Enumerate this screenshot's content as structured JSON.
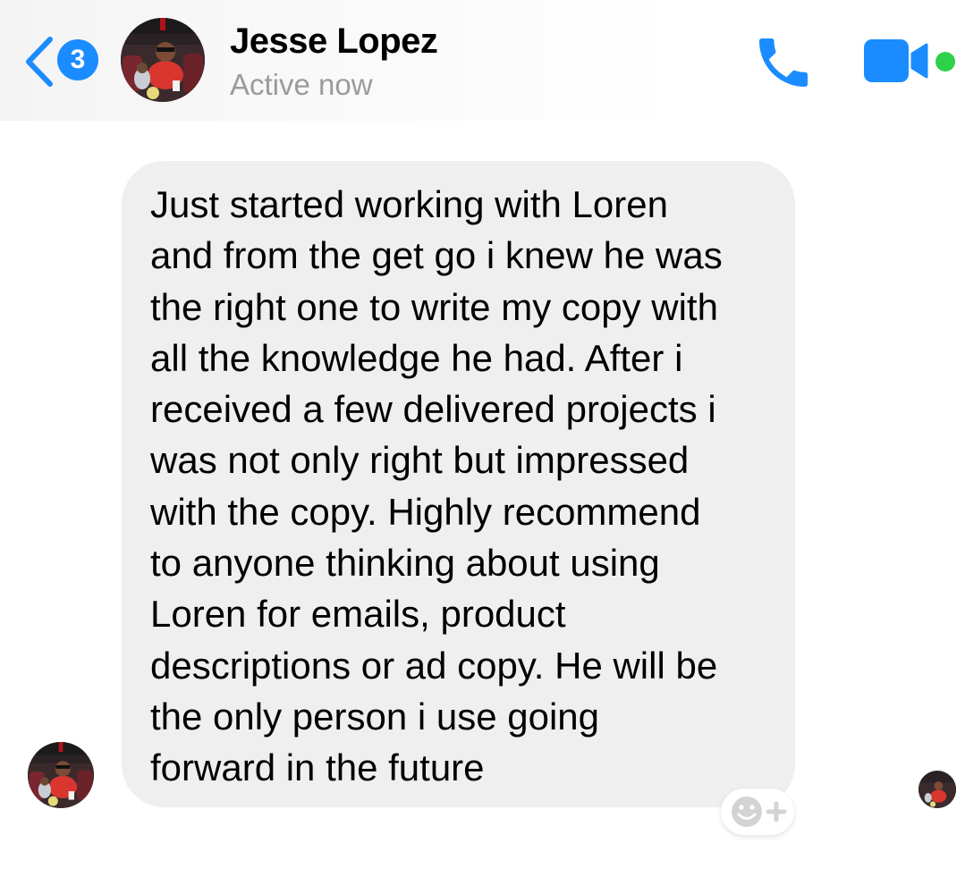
{
  "header": {
    "unread_count": "3",
    "contact_name": "Jesse Lopez",
    "status": "Active now",
    "accent_color": "#1a8cff",
    "online_color": "#2ed14a",
    "icons": {
      "back": "chevron-left-icon",
      "call": "phone-icon",
      "video": "video-camera-icon"
    }
  },
  "conversation": {
    "messages": [
      {
        "sender": "Jesse Lopez",
        "text": "Just started working with Loren\nand from the get go i knew he was\nthe right one to write my copy with\nall the knowledge he had. After i\nreceived a few delivered projects i\nwas not only right but impressed\nwith the copy. Highly recommend\nto anyone thinking about using\nLoren for emails, product\ndescriptions or ad copy. He will be\nthe only person i use going\nforward in the future",
        "bubble_color": "#efefef"
      }
    ],
    "reaction_icon": "smiley-add-icon"
  }
}
